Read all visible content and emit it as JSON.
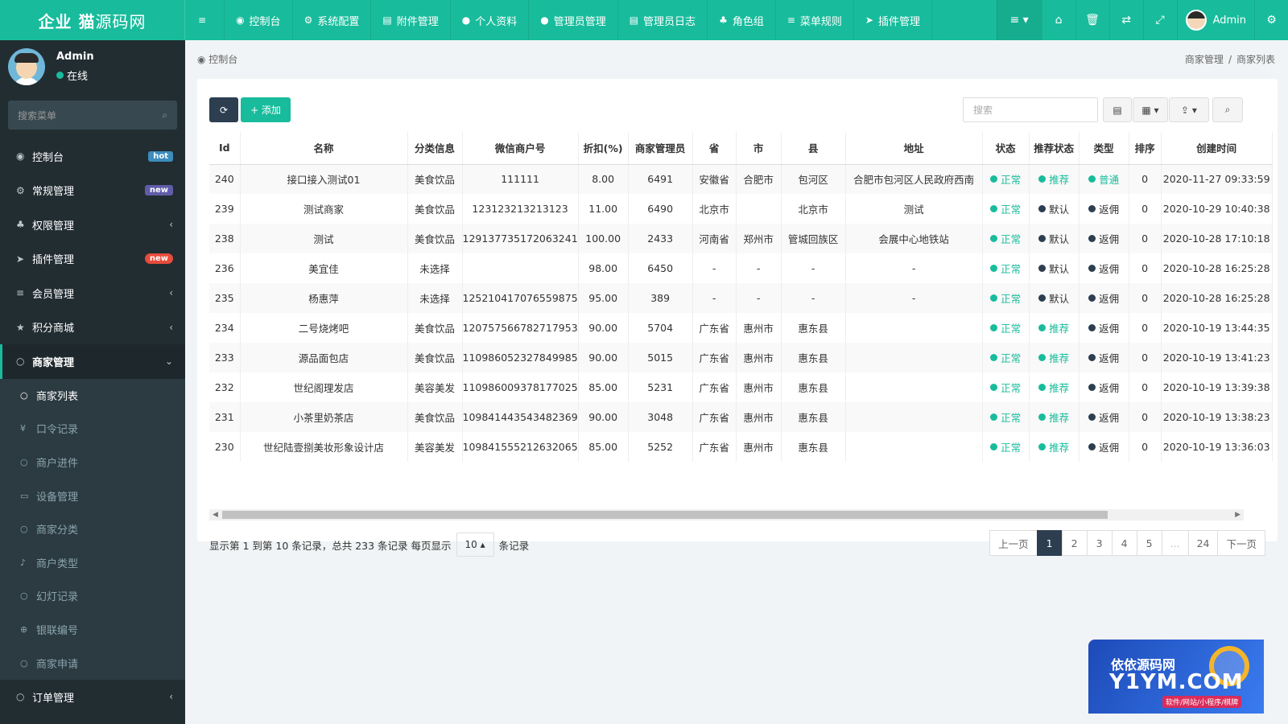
{
  "brand": {
    "bold": "企业 猫",
    "thin": "源码网"
  },
  "topnav": [
    {
      "icon": "≡",
      "label": ""
    },
    {
      "icon": "◉",
      "label": "控制台"
    },
    {
      "icon": "⚙",
      "label": "系统配置"
    },
    {
      "icon": "▤",
      "label": "附件管理"
    },
    {
      "icon": "●",
      "label": "个人资料"
    },
    {
      "icon": "●",
      "label": "管理员管理"
    },
    {
      "icon": "▤",
      "label": "管理员日志"
    },
    {
      "icon": "♣",
      "label": "角色组"
    },
    {
      "icon": "≡",
      "label": "菜单规则"
    },
    {
      "icon": "➤",
      "label": "插件管理"
    }
  ],
  "top_right": {
    "user": "Admin"
  },
  "sidebar": {
    "user_name": "Admin",
    "user_status": "在线",
    "search_placeholder": "搜索菜单",
    "items": [
      {
        "icon": "◉",
        "label": "控制台",
        "badge": "hot"
      },
      {
        "icon": "⚙",
        "label": "常规管理",
        "badge": "new"
      },
      {
        "icon": "♣",
        "label": "权限管理",
        "badge": ""
      },
      {
        "icon": "➤",
        "label": "插件管理",
        "badge": "new"
      },
      {
        "icon": "≡",
        "label": "会员管理",
        "badge": ""
      },
      {
        "icon": "★",
        "label": "积分商城",
        "badge": ""
      },
      {
        "icon": "○",
        "label": "商家管理",
        "badge": ""
      }
    ],
    "sub_items": [
      {
        "icon": "○",
        "label": "商家列表"
      },
      {
        "icon": "¥",
        "label": "口令记录"
      },
      {
        "icon": "○",
        "label": "商户进件"
      },
      {
        "icon": "▭",
        "label": "设备管理"
      },
      {
        "icon": "○",
        "label": "商家分类"
      },
      {
        "icon": "♪",
        "label": "商户类型"
      },
      {
        "icon": "○",
        "label": "幻灯记录"
      },
      {
        "icon": "⊕",
        "label": "银联编号"
      },
      {
        "icon": "○",
        "label": "商家申请"
      }
    ],
    "last_item": {
      "icon": "○",
      "label": "订单管理"
    }
  },
  "breadcrumb": {
    "left": "控制台",
    "right": [
      "商家管理",
      "商家列表"
    ]
  },
  "toolbar": {
    "refresh": "⟳",
    "add": "+ 添加",
    "search_placeholder": "搜索"
  },
  "table": {
    "headers": [
      "Id",
      "名称",
      "分类信息",
      "微信商户号",
      "折扣(%)",
      "商家管理员",
      "省",
      "市",
      "县",
      "地址",
      "状态",
      "推荐状态",
      "类型",
      "排序",
      "创建时间"
    ],
    "rows": [
      [
        "240",
        "接口接入测试01",
        "美食饮品",
        "111111",
        "8.00",
        "6491",
        "安徽省",
        "合肥市",
        "包河区",
        "合肥市包河区人民政府西南",
        "正常",
        "推荐",
        "普通",
        "0",
        "2020-11-27 09:33:59"
      ],
      [
        "239",
        "测试商家",
        "美食饮品",
        "123123213213123",
        "11.00",
        "6490",
        "北京市",
        "",
        "北京市",
        "测试",
        "正常",
        "默认",
        "返佣",
        "0",
        "2020-10-29 10:40:38"
      ],
      [
        "238",
        "测试",
        "美食饮品",
        "129137735172063241",
        "100.00",
        "2433",
        "河南省",
        "郑州市",
        "管城回族区",
        "会展中心地铁站",
        "正常",
        "默认",
        "返佣",
        "0",
        "2020-10-28 17:10:18"
      ],
      [
        "236",
        "美宜佳",
        "未选择",
        "",
        "98.00",
        "6450",
        "-",
        "-",
        "-",
        "-",
        "正常",
        "默认",
        "返佣",
        "0",
        "2020-10-28 16:25:28"
      ],
      [
        "235",
        "杨惠萍",
        "未选择",
        "125210417076559875",
        "95.00",
        "389",
        "-",
        "-",
        "-",
        "-",
        "正常",
        "默认",
        "返佣",
        "0",
        "2020-10-28 16:25:28"
      ],
      [
        "234",
        "二号烧烤吧",
        "美食饮品",
        "120757566782717953",
        "90.00",
        "5704",
        "广东省",
        "惠州市",
        "惠东县",
        "",
        "正常",
        "推荐",
        "返佣",
        "0",
        "2020-10-19 13:44:35"
      ],
      [
        "233",
        "源品面包店",
        "美食饮品",
        "110986052327849985",
        "90.00",
        "5015",
        "广东省",
        "惠州市",
        "惠东县",
        "",
        "正常",
        "推荐",
        "返佣",
        "0",
        "2020-10-19 13:41:23"
      ],
      [
        "232",
        "世纪阁理发店",
        "美容美发",
        "110986009378177025",
        "85.00",
        "5231",
        "广东省",
        "惠州市",
        "惠东县",
        "",
        "正常",
        "推荐",
        "返佣",
        "0",
        "2020-10-19 13:39:38"
      ],
      [
        "231",
        "小茶里奶茶店",
        "美食饮品",
        "109841443543482369",
        "90.00",
        "3048",
        "广东省",
        "惠州市",
        "惠东县",
        "",
        "正常",
        "推荐",
        "返佣",
        "0",
        "2020-10-19 13:38:23"
      ],
      [
        "230",
        "世纪陆壹捌美妆形象设计店",
        "美容美发",
        "109841555212632065",
        "85.00",
        "5252",
        "广东省",
        "惠州市",
        "惠东县",
        "",
        "正常",
        "推荐",
        "返佣",
        "0",
        "2020-10-19 13:36:03"
      ]
    ]
  },
  "pagination": {
    "info_prefix": "显示第 1 到第 10 条记录，总共 233 条记录 每页显示",
    "page_size": "10 ▴",
    "info_suffix": "条记录",
    "pages": [
      "上一页",
      "1",
      "2",
      "3",
      "4",
      "5",
      "...",
      "24",
      "下一页"
    ]
  },
  "watermark": {
    "line1": "依依源码网",
    "line2": "Y1YM.COM",
    "line3": "软件/网站/小程序/棋牌"
  },
  "colors": {
    "brand": "#18bc9c",
    "sidebar": "#222d32",
    "active_page": "#2c3e50"
  }
}
